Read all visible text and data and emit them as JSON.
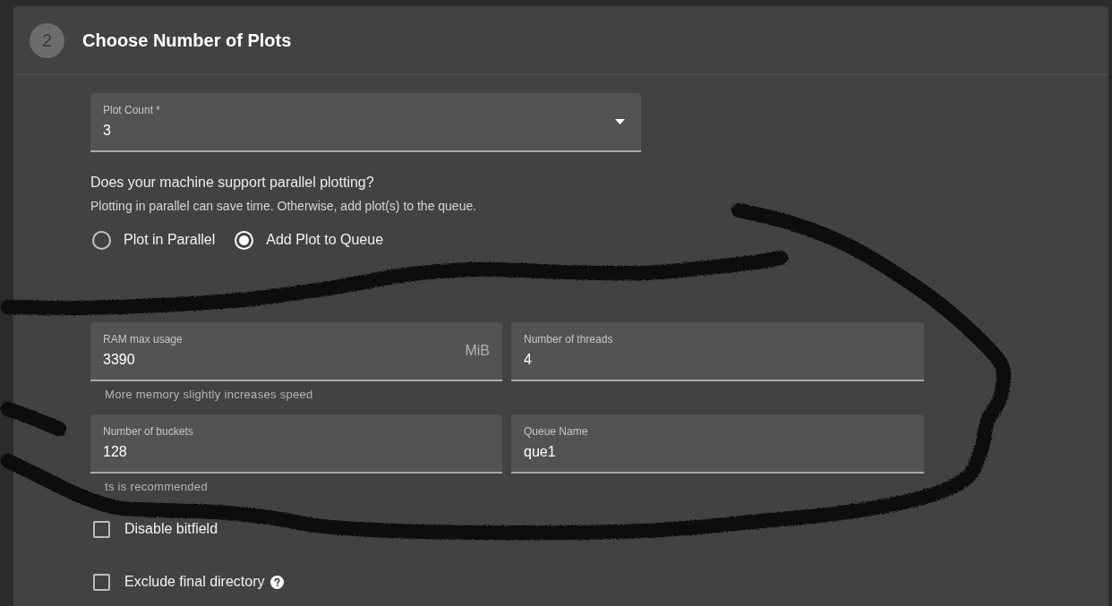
{
  "step": {
    "number": "2",
    "title": "Choose Number of Plots"
  },
  "plot_count": {
    "label": "Plot Count *",
    "value": "3"
  },
  "parallel": {
    "question": "Does your machine support parallel plotting?",
    "hint": "Plotting in parallel can save time. Otherwise, add plot(s) to the queue.",
    "options": [
      {
        "label": "Plot in Parallel",
        "selected": false
      },
      {
        "label": "Add Plot to Queue",
        "selected": true
      }
    ]
  },
  "advanced_fields": [
    {
      "label": "RAM max usage",
      "value": "3390",
      "suffix": "MiB",
      "helper": "More memory slightly increases speed"
    },
    {
      "label": "Number of threads",
      "value": "4"
    },
    {
      "label": "Number of buckets",
      "value": "128",
      "helper": "ts is recommended"
    },
    {
      "label": "Queue Name",
      "value": "que1"
    }
  ],
  "checkboxes": [
    {
      "label": "Disable bitfield",
      "checked": false,
      "help": false
    },
    {
      "label": "Exclude final directory",
      "checked": false,
      "help": true
    }
  ]
}
